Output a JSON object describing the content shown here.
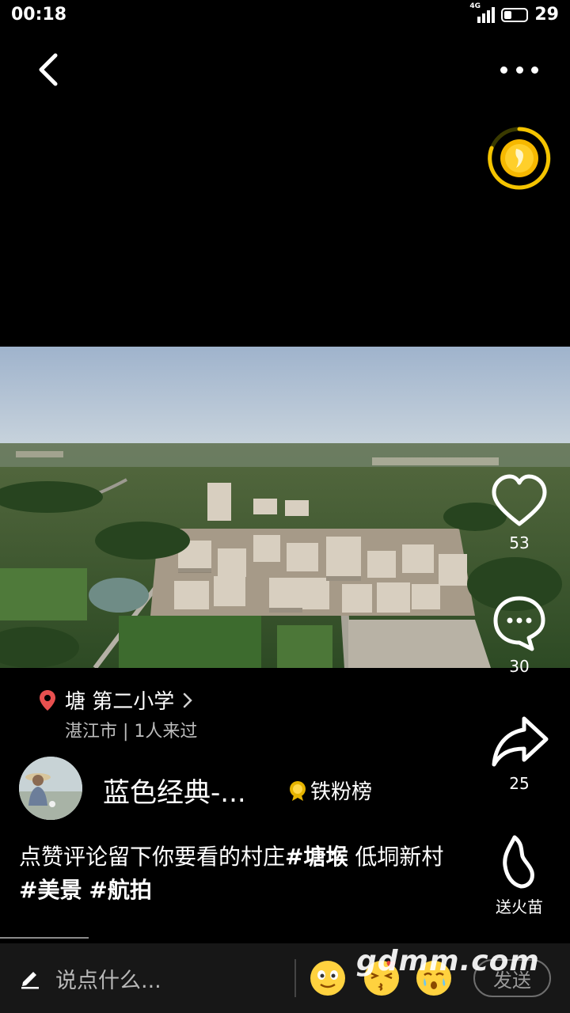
{
  "status_bar": {
    "time": "00:18",
    "network": "4G",
    "battery": "29"
  },
  "video": {
    "description_icon": "aerial-village-video"
  },
  "actions": {
    "like_count": "53",
    "comment_count": "30",
    "share_count": "25",
    "fire_label": "送火苗"
  },
  "location": {
    "name": "塘 第二小学",
    "sub": "湛江市 | 1人来过"
  },
  "author": {
    "name": "蓝色经典-...",
    "fan_rank": "铁粉榜"
  },
  "caption": {
    "text": "点赞评论留下你要看的村庄",
    "tag1": "#塘堠",
    "text2": " 低垌新村 ",
    "tag2": "#美景",
    "tag3": "#航拍"
  },
  "bottom_bar": {
    "input_placeholder": "说点什么...",
    "send_label": "发送"
  },
  "watermark": "gdmm.com",
  "colors": {
    "coin_ring": "#f5c400",
    "pin": "#e8504f",
    "background": "#000000"
  }
}
